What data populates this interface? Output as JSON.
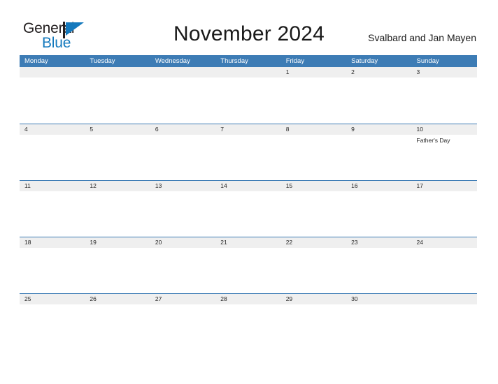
{
  "brand": {
    "word_one": "General",
    "word_two": "Blue",
    "mark": "triangle-flag-icon",
    "accent_color": "#1479bd",
    "text_color": "#231f20"
  },
  "header": {
    "title": "November 2024",
    "region": "Svalbard and Jan Mayen"
  },
  "calendar": {
    "header_bg": "#3d7cb5",
    "band_bg": "#efefef",
    "rule_color": "#3d7cb5",
    "weekday_headers": [
      "Monday",
      "Tuesday",
      "Wednesday",
      "Thursday",
      "Friday",
      "Saturday",
      "Sunday"
    ],
    "weeks": [
      {
        "days": [
          {
            "num": "",
            "events": []
          },
          {
            "num": "",
            "events": []
          },
          {
            "num": "",
            "events": []
          },
          {
            "num": "",
            "events": []
          },
          {
            "num": "1",
            "events": []
          },
          {
            "num": "2",
            "events": []
          },
          {
            "num": "3",
            "events": []
          }
        ]
      },
      {
        "days": [
          {
            "num": "4",
            "events": []
          },
          {
            "num": "5",
            "events": []
          },
          {
            "num": "6",
            "events": []
          },
          {
            "num": "7",
            "events": []
          },
          {
            "num": "8",
            "events": []
          },
          {
            "num": "9",
            "events": []
          },
          {
            "num": "10",
            "events": [
              "Father's Day"
            ]
          }
        ]
      },
      {
        "days": [
          {
            "num": "11",
            "events": []
          },
          {
            "num": "12",
            "events": []
          },
          {
            "num": "13",
            "events": []
          },
          {
            "num": "14",
            "events": []
          },
          {
            "num": "15",
            "events": []
          },
          {
            "num": "16",
            "events": []
          },
          {
            "num": "17",
            "events": []
          }
        ]
      },
      {
        "days": [
          {
            "num": "18",
            "events": []
          },
          {
            "num": "19",
            "events": []
          },
          {
            "num": "20",
            "events": []
          },
          {
            "num": "21",
            "events": []
          },
          {
            "num": "22",
            "events": []
          },
          {
            "num": "23",
            "events": []
          },
          {
            "num": "24",
            "events": []
          }
        ]
      },
      {
        "days": [
          {
            "num": "25",
            "events": []
          },
          {
            "num": "26",
            "events": []
          },
          {
            "num": "27",
            "events": []
          },
          {
            "num": "28",
            "events": []
          },
          {
            "num": "29",
            "events": []
          },
          {
            "num": "30",
            "events": []
          },
          {
            "num": "",
            "events": []
          }
        ]
      }
    ]
  }
}
